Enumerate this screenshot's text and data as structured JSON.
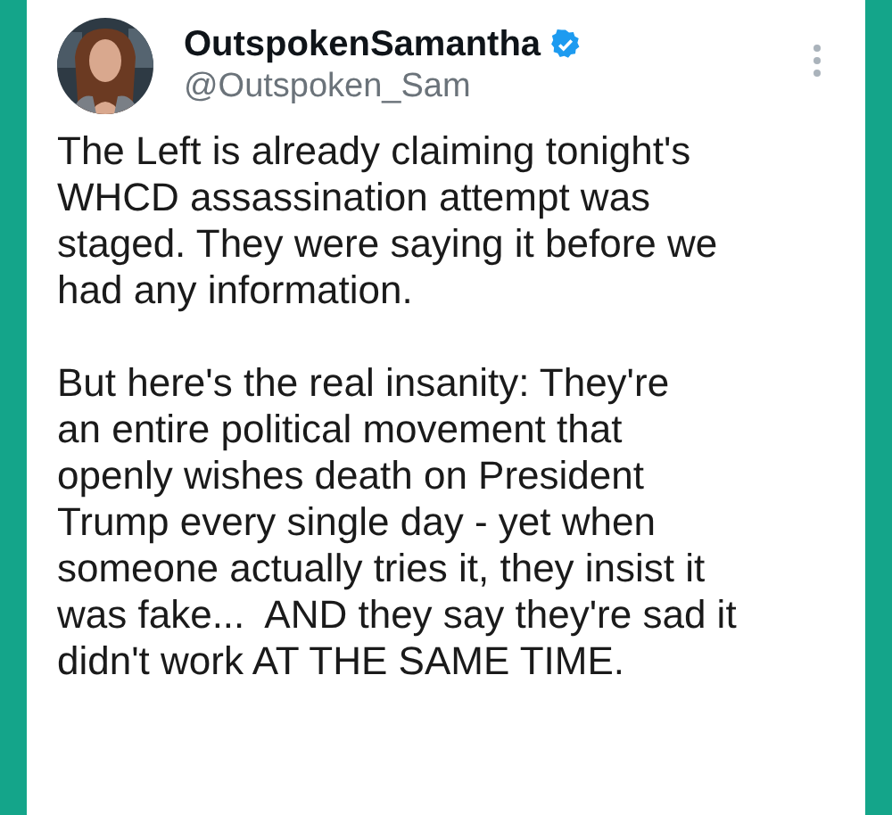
{
  "author": {
    "name": "OutspokenSamantha",
    "verified": true,
    "handle": "@Outspoken_Sam"
  },
  "paragraphs": [
    {
      "lines": [
        "The Left is already claiming tonight's",
        "WHCD assassination attempt was",
        "staged. They were saying it before we",
        "had any information."
      ]
    },
    {
      "lines": [
        "But here's the real insanity: They're",
        "an entire political movement that",
        "openly wishes death on President",
        "Trump every single day - yet when",
        "someone actually tries it, they insist it",
        "was fake...  AND they say they're sad it",
        "didn't work AT THE SAME TIME."
      ]
    }
  ]
}
